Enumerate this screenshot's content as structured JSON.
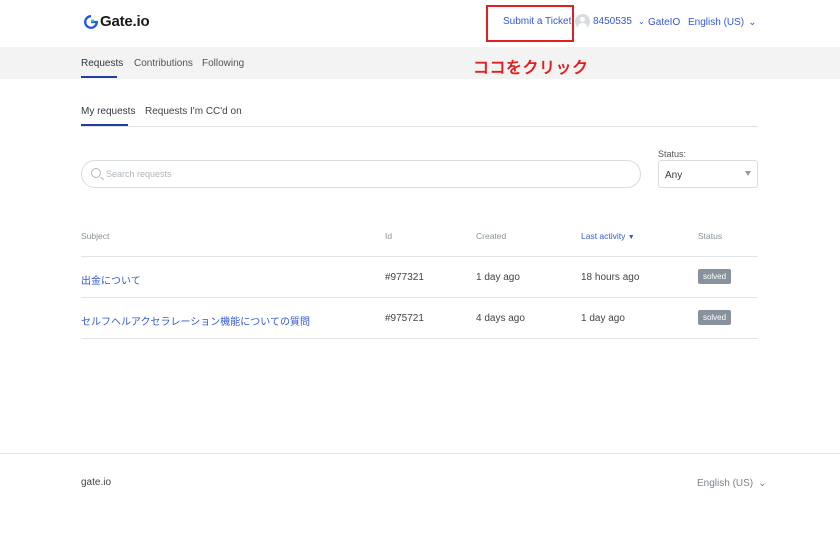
{
  "header": {
    "logo_text": "Gate.io",
    "submit_ticket_label": "Submit a Ticket",
    "annotation": "ココをクリック",
    "username": "8450535",
    "gateio_link": "GateIO",
    "language": "English (US)"
  },
  "subnav": {
    "items": [
      "Requests",
      "Contributions",
      "Following"
    ],
    "active": "Requests"
  },
  "tabs": {
    "items": [
      "My requests",
      "Requests I'm CC'd on"
    ],
    "active": "My requests"
  },
  "search": {
    "placeholder": "Search requests",
    "value": ""
  },
  "status_filter": {
    "label": "Status:",
    "selected": "Any"
  },
  "table": {
    "columns": {
      "subject": "Subject",
      "id": "Id",
      "created": "Created",
      "last_activity": "Last activity",
      "status": "Status"
    },
    "sort_indicator": "▼",
    "rows": [
      {
        "subject": "出金について",
        "id": "#977321",
        "created": "1 day ago",
        "last_activity": "18 hours ago",
        "status": "solved"
      },
      {
        "subject": "セルフヘルアクセラレーション機能についての質問",
        "id": "#975721",
        "created": "4 days ago",
        "last_activity": "1 day ago",
        "status": "solved"
      }
    ]
  },
  "footer": {
    "brand": "gate.io",
    "language": "English (US)"
  },
  "icons": {
    "logo": "gate-logo-icon",
    "avatar": "user-avatar-icon",
    "chevron": "chevron-down-icon",
    "search": "search-icon",
    "caret": "dropdown-caret-icon"
  },
  "colors": {
    "link": "#3558d4",
    "annotation": "#e02020",
    "active_underline": "#1f3ea8",
    "badge": "#87929d"
  }
}
